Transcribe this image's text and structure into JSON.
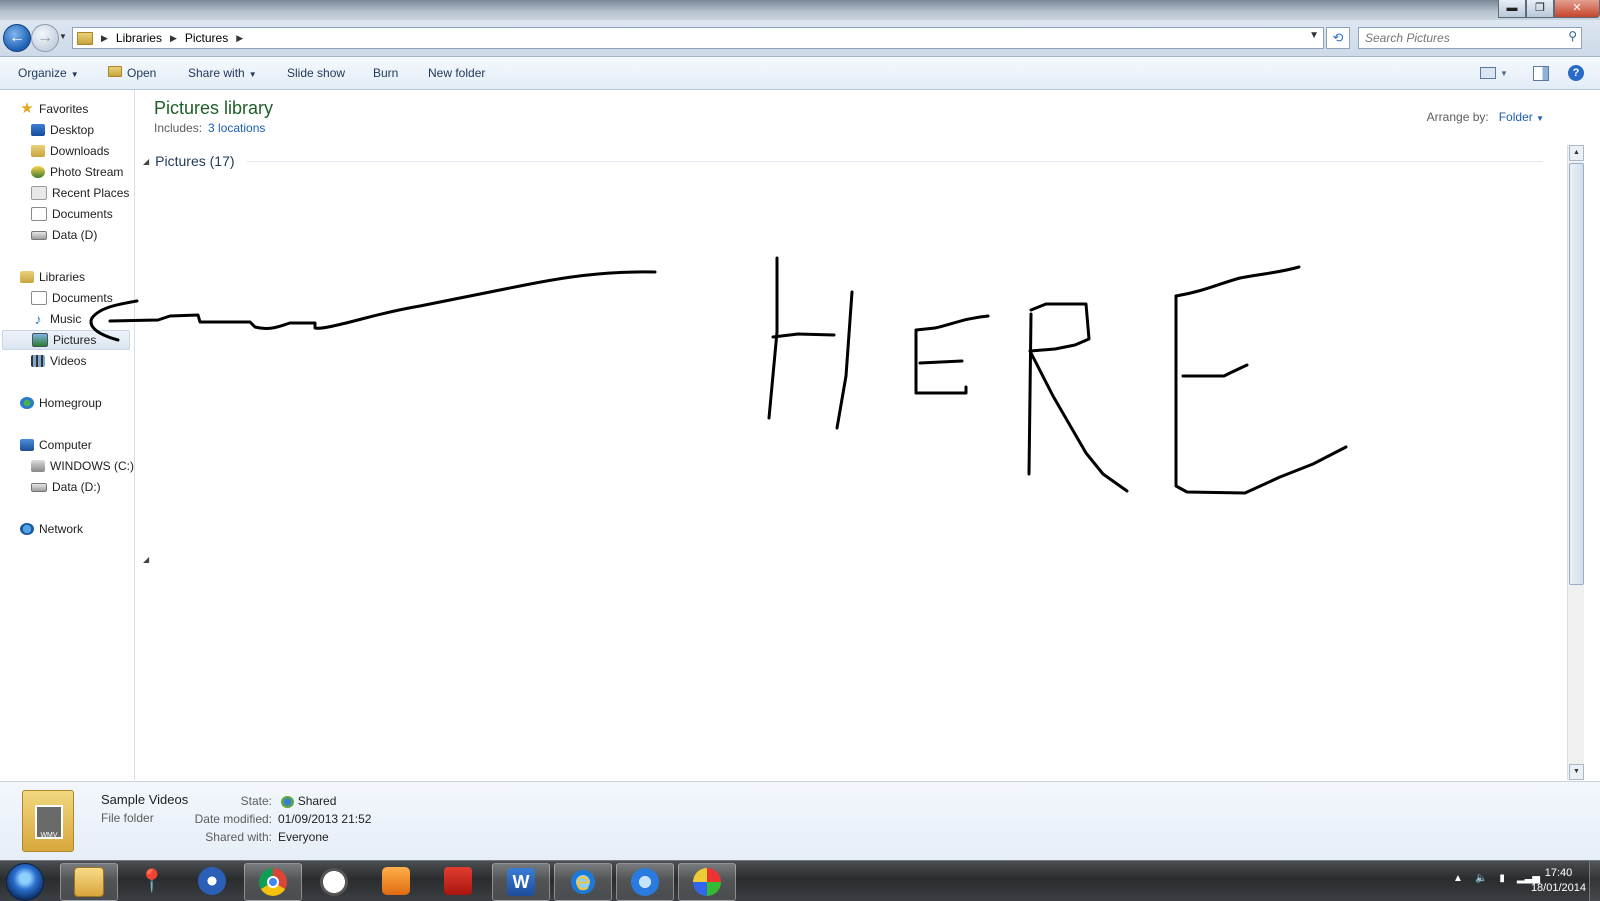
{
  "window": {
    "controls": {
      "minimize": "▬",
      "maximize": "❐",
      "close": "✕"
    }
  },
  "address": {
    "back_glyph": "←",
    "forward_glyph": "→",
    "crumbs": [
      "Libraries",
      "Pictures"
    ],
    "search_placeholder": "Search Pictures"
  },
  "toolbar": {
    "organize": "Organize",
    "open": "Open",
    "share_with": "Share with",
    "slide_show": "Slide show",
    "burn": "Burn",
    "new_folder": "New folder",
    "help": "?"
  },
  "nav": {
    "favorites": {
      "label": "Favorites",
      "items": [
        "Desktop",
        "Downloads",
        "Photo Stream",
        "Recent Places",
        "Documents",
        "Data (D)"
      ]
    },
    "libraries": {
      "label": "Libraries",
      "items": [
        "Documents",
        "Music",
        "Pictures",
        "Videos"
      ],
      "selected": "Pictures"
    },
    "homegroup": "Homegroup",
    "computer": {
      "label": "Computer",
      "items": [
        "WINDOWS (C:)",
        "Data (D:)"
      ]
    },
    "network": "Network"
  },
  "library": {
    "title": "Pictures library",
    "includes_label": "Includes:",
    "includes_link": "3 locations",
    "arrange_label": "Arrange by:",
    "arrange_value": "Folder",
    "group_header": "Pictures (17)"
  },
  "annotation": {
    "handwritten_text": "HERE",
    "color": "#000000"
  },
  "details": {
    "name": "Sample Videos",
    "type": "File folder",
    "state_label": "State:",
    "state_value": "Shared",
    "modified_label": "Date modified:",
    "modified_value": "01/09/2013 21:52",
    "shared_label": "Shared with:",
    "shared_value": "Everyone",
    "thumb_text": "WMV"
  },
  "taskbar": {
    "apps": [
      "explorer-icon",
      "pin-icon",
      "user-icon",
      "chrome-icon",
      "clock-icon",
      "media-player-icon",
      "pdf-icon",
      "word-icon",
      "ie-icon",
      "itunes-icon",
      "paint-icon"
    ],
    "word_letter": "W",
    "ie_letter": "e",
    "time": "17:40",
    "date": "18/01/2014"
  }
}
